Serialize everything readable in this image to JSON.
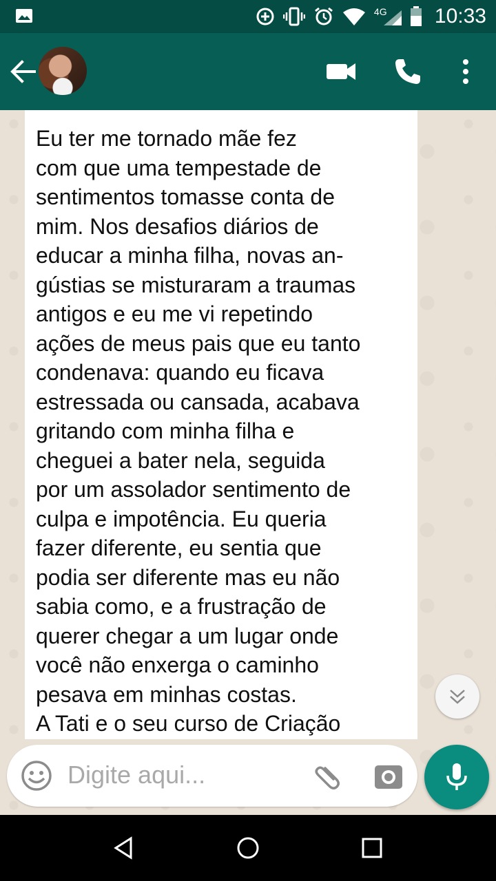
{
  "status_bar": {
    "network_type": "4G",
    "time": "10:33",
    "icons": [
      "image-notification-icon",
      "data-saver-icon",
      "vibrate-icon",
      "alarm-icon",
      "wifi-icon",
      "signal-icon",
      "battery-icon"
    ]
  },
  "header": {
    "icons": [
      "back-arrow-icon",
      "avatar",
      "video-call-icon",
      "voice-call-icon",
      "more-options-icon"
    ]
  },
  "message": {
    "lines": [
      "Eu ter me tornado mãe fez",
      "com que uma tempestade de",
      "sentimentos tomasse conta de",
      "mim. Nos desafios diários de",
      "educar a minha filha, novas an-",
      "gústias se misturaram a traumas",
      "antigos e eu me vi repetindo",
      "ações de meus pais que eu tanto",
      "condenava: quando eu ficava",
      "estressada ou cansada, acabava",
      "gritando com minha filha e",
      "cheguei a bater nela, seguida",
      "por um assolador sentimento de",
      "culpa e impotência. Eu queria",
      "fazer diferente, eu sentia que",
      "podia ser diferente mas eu não",
      "sabia como, e a frustração de",
      "querer chegar a um lugar onde",
      "você não enxerga o caminho",
      "pesava em minhas costas.",
      "A Tati e o seu curso de Criação"
    ]
  },
  "composer": {
    "placeholder": "Digite aqui..."
  },
  "colors": {
    "header": "#075e54",
    "status_bar": "#054d44",
    "mic_button": "#0a8d7f",
    "chat_background": "#e9e1d5"
  }
}
